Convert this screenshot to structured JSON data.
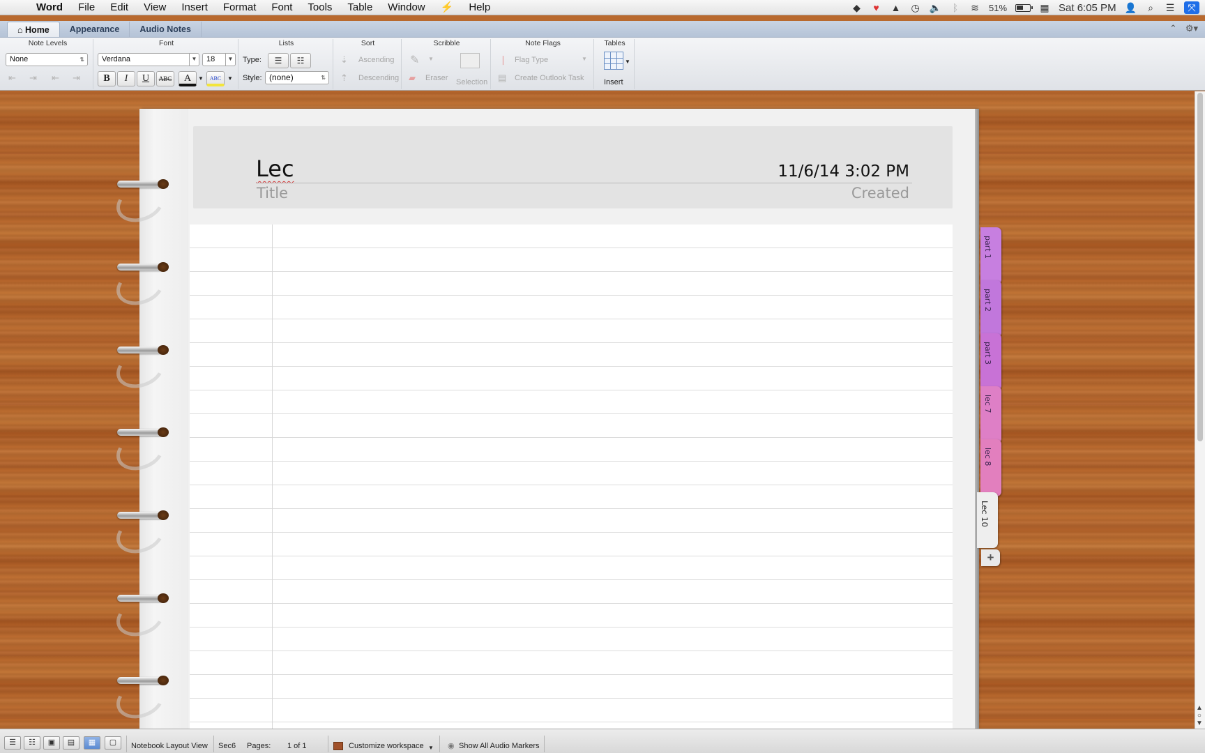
{
  "menubar": {
    "app_name": "Word",
    "items": [
      "File",
      "Edit",
      "View",
      "Insert",
      "Format",
      "Font",
      "Tools",
      "Table",
      "Window",
      "Help"
    ],
    "battery": "51%",
    "clock": "Sat 6:05 PM"
  },
  "ribbon": {
    "tabs": [
      "Home",
      "Appearance",
      "Audio Notes"
    ],
    "groups": {
      "note_levels": {
        "title": "Note Levels",
        "value": "None"
      },
      "font": {
        "title": "Font",
        "font_name": "Verdana",
        "font_size": "18",
        "bold": "B",
        "italic": "I",
        "underline": "U",
        "strike": "ABC",
        "font_color": "A",
        "highlight": "ABC"
      },
      "lists": {
        "title": "Lists",
        "type_label": "Type:",
        "style_label": "Style:",
        "style_value": "(none)"
      },
      "sort": {
        "title": "Sort",
        "ascending": "Ascending",
        "descending": "Descending"
      },
      "scribble": {
        "title": "Scribble",
        "eraser": "Eraser",
        "selection": "Selection"
      },
      "note_flags": {
        "title": "Note Flags",
        "flag_type": "Flag Type",
        "create_task": "Create Outlook Task"
      },
      "tables": {
        "title": "Tables",
        "insert": "Insert"
      }
    }
  },
  "note": {
    "title": "Lec",
    "title_label": "Title",
    "created": "11/6/14 3:02 PM",
    "created_label": "Created"
  },
  "section_tabs": [
    {
      "label": "part 1",
      "color": "#c77fe0"
    },
    {
      "label": "part 2",
      "color": "#c177dc"
    },
    {
      "label": "part 3",
      "color": "#c872d6"
    },
    {
      "label": "lec 7",
      "color": "#de7fc6"
    },
    {
      "label": "lec 8",
      "color": "#e27fbe"
    },
    {
      "label": "Lec 10",
      "color": "#eeeeee",
      "active": true
    }
  ],
  "statusbar": {
    "view_name": "Notebook Layout View",
    "section": "Sec6",
    "pages_label": "Pages:",
    "pages_value": "1 of 1",
    "customize": "Customize workspace",
    "audio": "Show All Audio Markers"
  }
}
